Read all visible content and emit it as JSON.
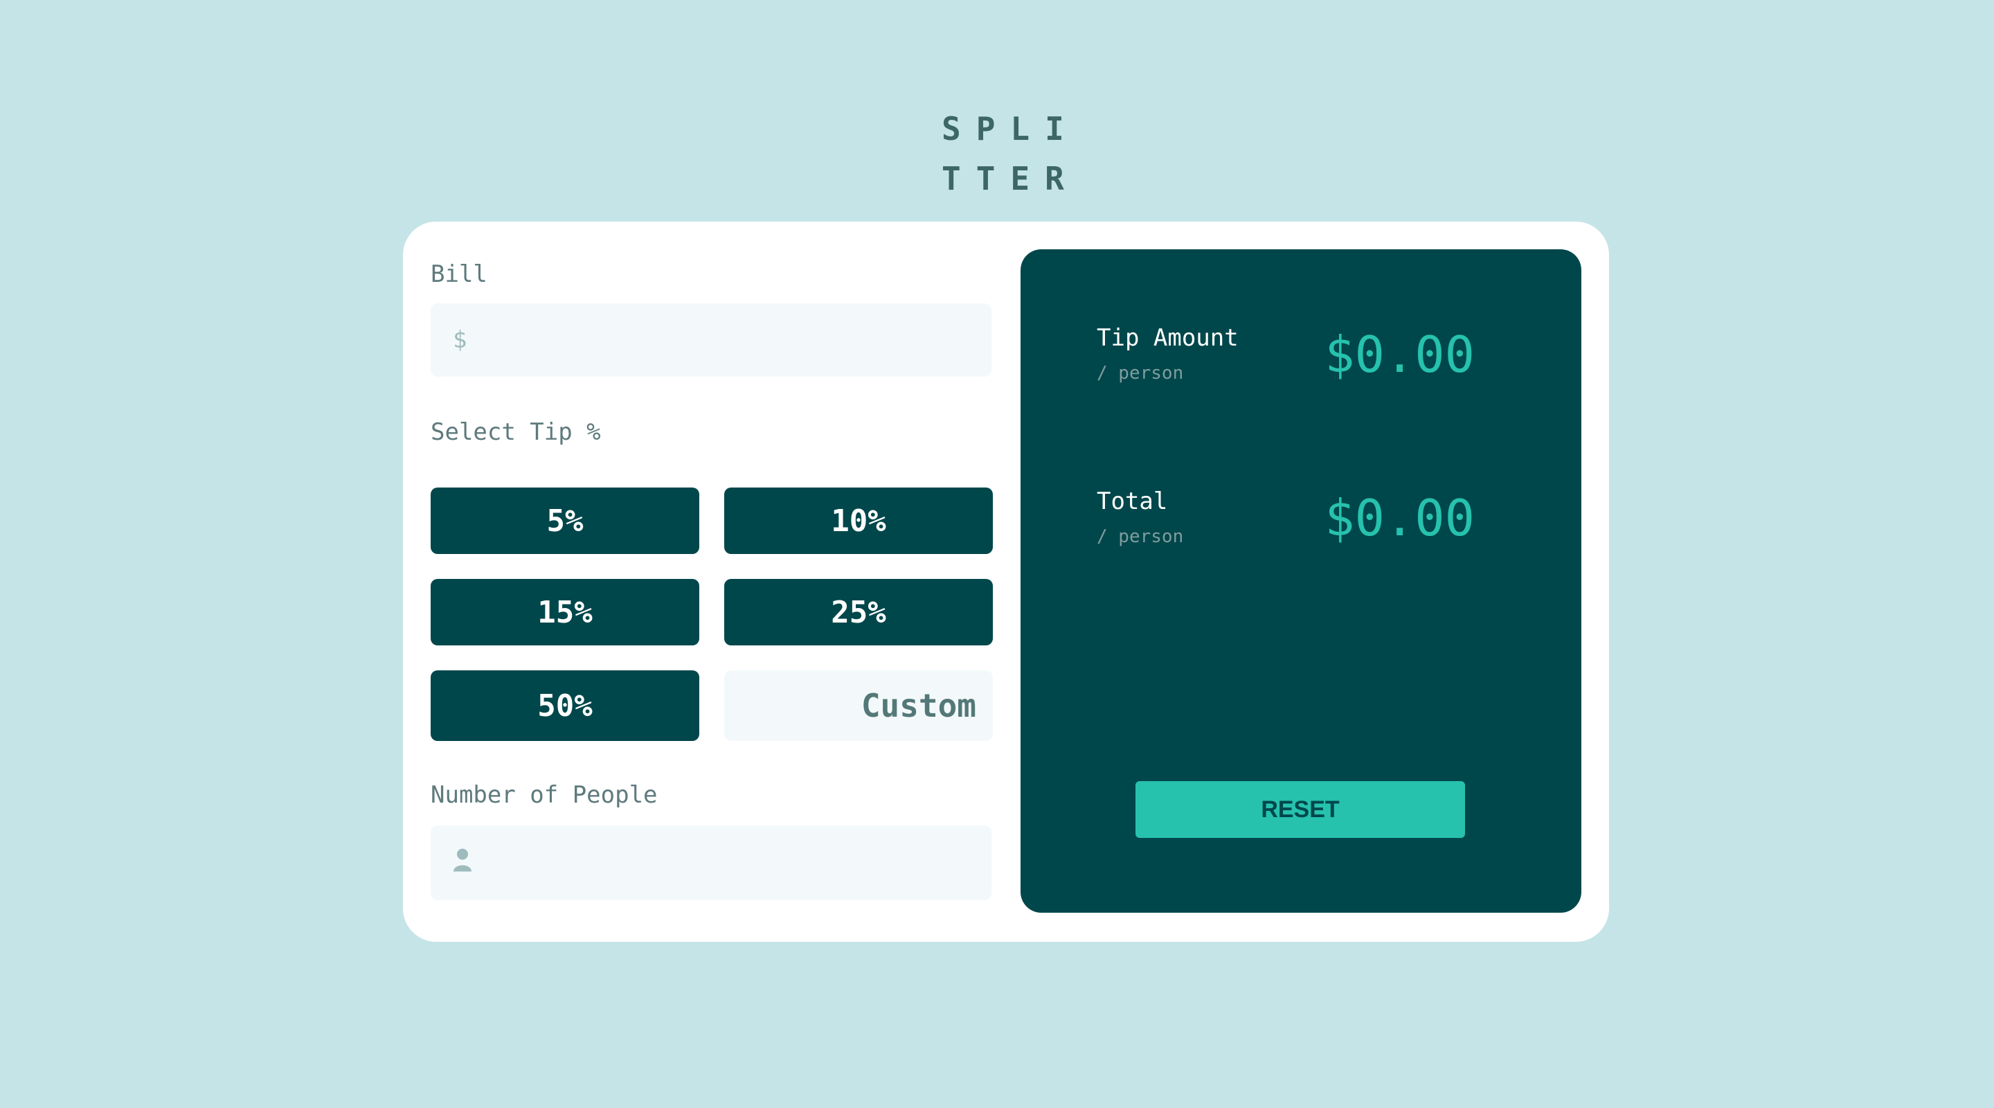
{
  "logo": {
    "line1": "SPLI",
    "line2": "TTER"
  },
  "bill": {
    "label": "Bill",
    "icon": "dollar-icon",
    "icon_glyph": "$",
    "value": ""
  },
  "tip": {
    "label": "Select Tip %",
    "options": [
      "5%",
      "10%",
      "15%",
      "25%",
      "50%"
    ],
    "custom_label": "Custom"
  },
  "people": {
    "label": "Number of People",
    "icon": "person-icon",
    "value": ""
  },
  "results": {
    "tip_amount": {
      "title": "Tip Amount",
      "sub": "/ person",
      "value": "$0.00"
    },
    "total": {
      "title": "Total",
      "sub": "/ person",
      "value": "$0.00"
    },
    "reset_label": "RESET"
  },
  "colors": {
    "background": "#c5e4e7",
    "dark_cyan": "#00474b",
    "accent": "#26c2ae",
    "input_bg": "#f3f9fa"
  }
}
